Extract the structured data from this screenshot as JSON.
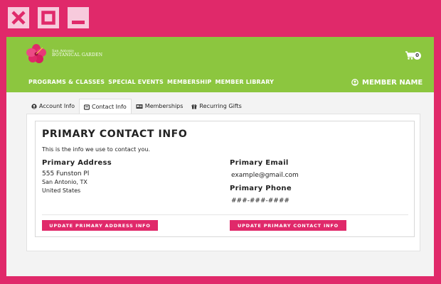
{
  "window_controls": {
    "close_icon": "close-x-icon",
    "maximize_icon": "maximize-square-icon",
    "minimize_icon": "minimize-bar-icon"
  },
  "header": {
    "logo_line1": "San Antonio",
    "logo_line2": "BOTANICAL GARDEN",
    "cart_count": "0",
    "nav": [
      "PROGRAMS & CLASSES",
      "SPECIAL EVENTS",
      "MEMBERSHIP",
      "MEMBER LIBRARY"
    ],
    "member_name": "MEMBER NAME",
    "colors": {
      "header_bg": "#8cc63f",
      "accent": "#e0296a"
    }
  },
  "tabs": [
    {
      "label": "Account Info",
      "icon": "user-circle-icon"
    },
    {
      "label": "Contact Info",
      "icon": "id-card-icon",
      "active": true
    },
    {
      "label": "Memberships",
      "icon": "membership-card-icon"
    },
    {
      "label": "Recurring Gifts",
      "icon": "gift-icon"
    }
  ],
  "contact": {
    "title": "PRIMARY CONTACT INFO",
    "description": "This is the info we use to contact you.",
    "address_heading": "Primary Address",
    "address_line1": "555 Funston Pl",
    "address_line2": "San Antonio, TX",
    "address_line3": "United States",
    "email_heading": "Primary Email",
    "email_value": "example@gmail.com",
    "phone_heading": "Primary Phone",
    "phone_value": "###-###-####",
    "update_address_button": "UPDATE PRIMARY ADDRESS INFO",
    "update_contact_button": "UPDATE PRIMARY CONTACT INFO"
  }
}
